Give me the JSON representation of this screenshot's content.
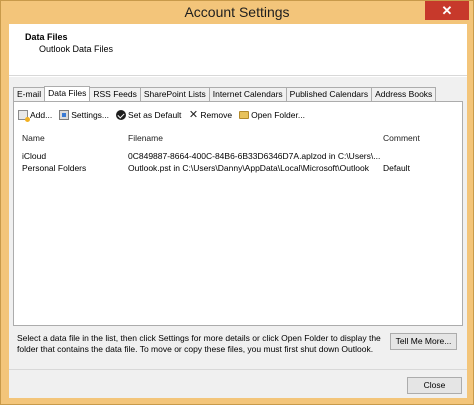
{
  "window": {
    "title": "Account Settings",
    "close_glyph": "✕"
  },
  "header": {
    "title": "Data Files",
    "subtitle": "Outlook Data Files"
  },
  "tabs": [
    {
      "label": "E-mail"
    },
    {
      "label": "Data Files"
    },
    {
      "label": "RSS Feeds"
    },
    {
      "label": "SharePoint Lists"
    },
    {
      "label": "Internet Calendars"
    },
    {
      "label": "Published Calendars"
    },
    {
      "label": "Address Books"
    }
  ],
  "active_tab": "Data Files",
  "toolbar": {
    "add_label": "Add...",
    "settings_label": "Settings...",
    "default_label": "Set as Default",
    "remove_label": "Remove",
    "open_label": "Open Folder...",
    "remove_glyph": "✕"
  },
  "columns": {
    "name": "Name",
    "filename": "Filename",
    "comment": "Comment"
  },
  "rows": [
    {
      "name": "iCloud",
      "filename": "0C849887-8664-400C-84B6-6B33D6346D7A.aplzod in C:\\Users\\...",
      "comment": ""
    },
    {
      "name": "Personal Folders",
      "filename": "Outlook.pst in C:\\Users\\Danny\\AppData\\Local\\Microsoft\\Outlook",
      "comment": "Default"
    }
  ],
  "info_text": "Select a data file in the list, then click Settings for more details or click Open Folder to display the folder that contains the data file. To move or copy these files, you must first shut down Outlook.",
  "buttons": {
    "tell_me": "Tell Me More...",
    "close": "Close"
  }
}
